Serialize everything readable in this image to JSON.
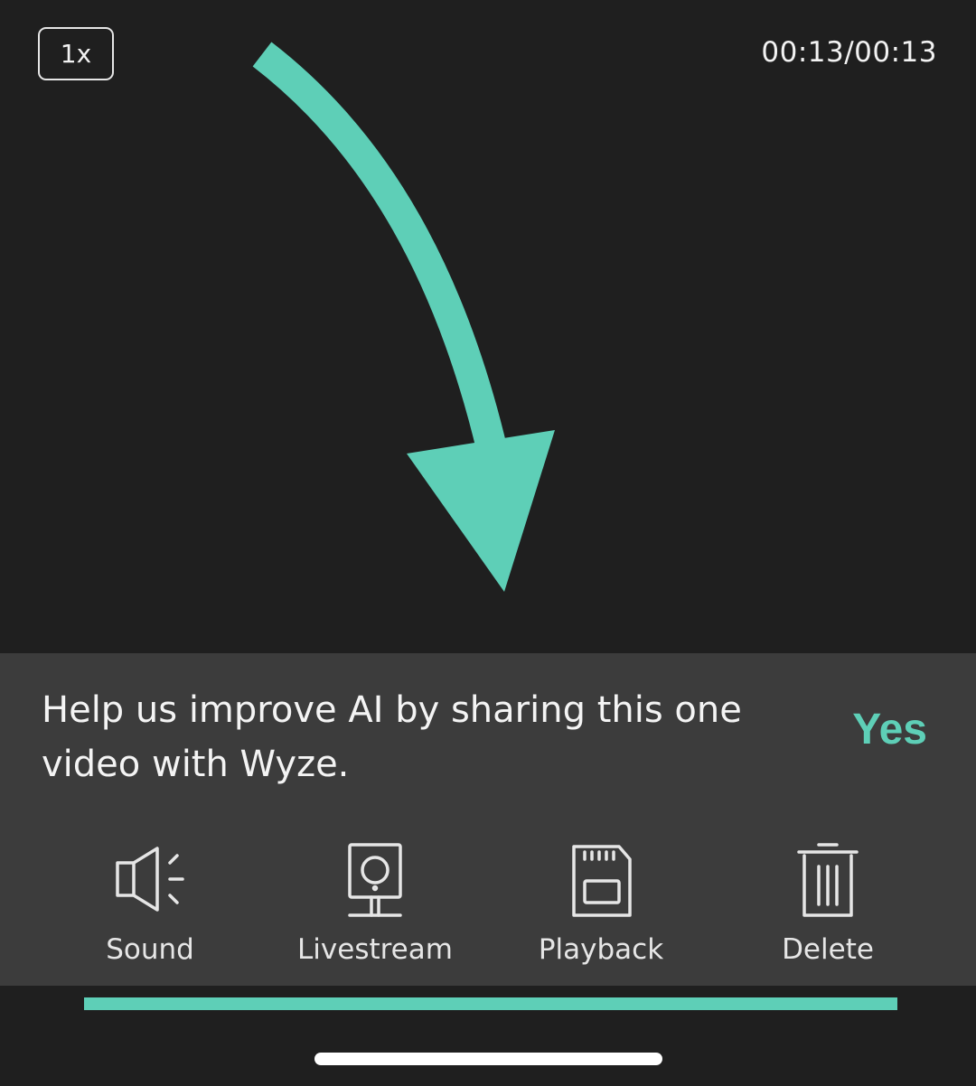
{
  "player": {
    "speed_label": "1x",
    "time_label": "00:13/00:13",
    "progress_fraction": 1.0
  },
  "share_prompt": {
    "text": "Help us improve AI by sharing this one video with Wyze.",
    "yes_label": "Yes"
  },
  "actions": [
    {
      "label": "Sound",
      "icon": "speaker-icon"
    },
    {
      "label": "Livestream",
      "icon": "camera-icon"
    },
    {
      "label": "Playback",
      "icon": "sd-card-icon"
    },
    {
      "label": "Delete",
      "icon": "trash-icon"
    }
  ],
  "colors": {
    "accent": "#5ecfb7",
    "background": "#1f1f1f",
    "panel": "#3c3c3c"
  }
}
